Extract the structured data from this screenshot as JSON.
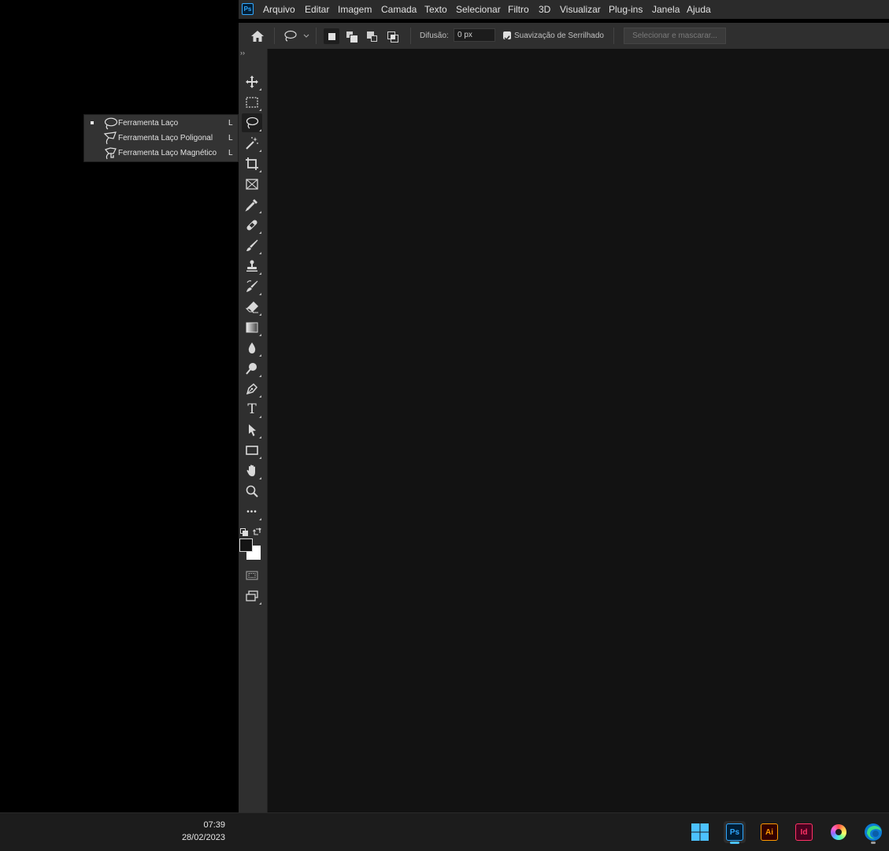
{
  "app": {
    "logo": "Ps"
  },
  "menu": [
    "Arquivo",
    "Editar",
    "Imagem",
    "Camada",
    "Texto",
    "Selecionar",
    "Filtro",
    "3D",
    "Visualizar",
    "Plug-ins",
    "Janela",
    "Ajuda"
  ],
  "options": {
    "feather_label": "Difusão:",
    "feather_value": "0 px",
    "antialias_label": "Suavização de Serrilhado",
    "antialias_checked": true,
    "select_mask_label": "Selecionar e mascarar..."
  },
  "toolbar": {
    "collapse": "››",
    "tools": [
      "move-icon",
      "marquee-icon",
      "lasso-icon",
      "magic-wand-icon",
      "crop-icon",
      "frame-icon",
      "eyedropper-icon",
      "healing-icon",
      "brush-icon",
      "stamp-icon",
      "history-brush-icon",
      "eraser-icon",
      "gradient-icon",
      "blur-icon",
      "dodge-icon",
      "pen-icon",
      "type-icon",
      "path-select-icon",
      "rectangle-icon",
      "hand-icon",
      "zoom-icon",
      "more-icon"
    ],
    "type_glyph": "T",
    "more_glyph": "•••"
  },
  "flyout": {
    "items": [
      {
        "label": "Ferramenta Laço",
        "key": "L",
        "active": true
      },
      {
        "label": "Ferramenta Laço Poligonal",
        "key": "L",
        "active": false
      },
      {
        "label": "Ferramenta Laço Magnético",
        "key": "L",
        "active": false
      }
    ]
  },
  "taskbar": {
    "time": "07:39",
    "date": "28/02/2023",
    "apps": [
      {
        "name": "Windows Start",
        "icon": "windows-icon"
      },
      {
        "name": "Photoshop",
        "label": "Ps",
        "color": "#31a8ff",
        "bg": "#001e36"
      },
      {
        "name": "Illustrator",
        "label": "Ai",
        "color": "#ff9a00",
        "bg": "#330000"
      },
      {
        "name": "InDesign",
        "label": "Id",
        "color": "#ff3366",
        "bg": "#49021f"
      },
      {
        "name": "Color app",
        "icon": "color-wheel-icon"
      },
      {
        "name": "Edge",
        "icon": "edge-icon"
      }
    ]
  }
}
